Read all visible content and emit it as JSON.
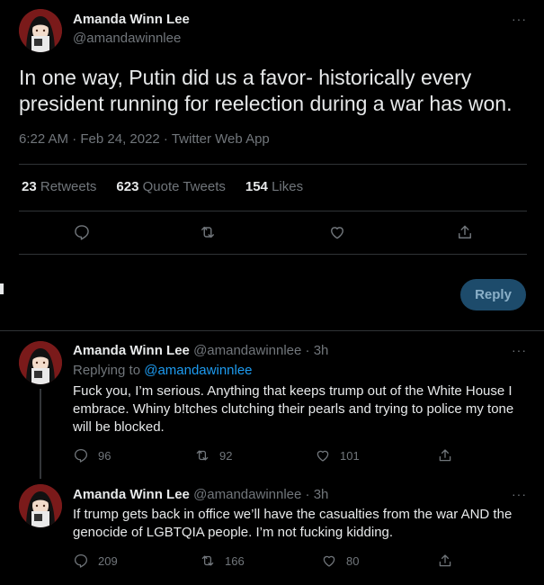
{
  "main_tweet": {
    "name": "Amanda Winn Lee",
    "handle": "@amandawinnlee",
    "text": "In one way, Putin did us a favor- historically every president running for reelection during a war has won.",
    "meta": "6:22 AM · Feb 24, 2022 · Twitter Web App",
    "stats": {
      "retweets_count": "23",
      "retweets_label": "Retweets",
      "quotes_count": "623",
      "quotes_label": "Quote Tweets",
      "likes_count": "154",
      "likes_label": "Likes"
    },
    "more_label": "···"
  },
  "reply_button_label": "Reply",
  "replies": [
    {
      "name": "Amanda Winn Lee",
      "handle_time": "@amandawinnlee · 3h",
      "replying_prefix": "Replying to",
      "replying_handle": "@amandawinnlee",
      "text": "Fuck you, I’m serious. Anything that keeps trump out of the White House I embrace. Whiny b!tches clutching their pearls and trying to police my tone will be blocked.",
      "replies": "96",
      "retweets": "92",
      "likes": "101"
    },
    {
      "name": "Amanda Winn Lee",
      "handle_time": "@amandawinnlee · 3h",
      "text": "If trump gets back in office we’ll have the casualties from the war AND the genocide of LGBTQIA people. I’m not fucking kidding.",
      "replies": "209",
      "retweets": "166",
      "likes": "80"
    }
  ],
  "icons": [
    "reply-icon",
    "retweet-icon",
    "like-icon",
    "share-icon",
    "more-icon"
  ],
  "colors": {
    "background": "#000000",
    "text": "#e7e9ea",
    "muted": "#71767b",
    "link": "#1d9bf0",
    "reply_button": "#1d4b6b"
  }
}
